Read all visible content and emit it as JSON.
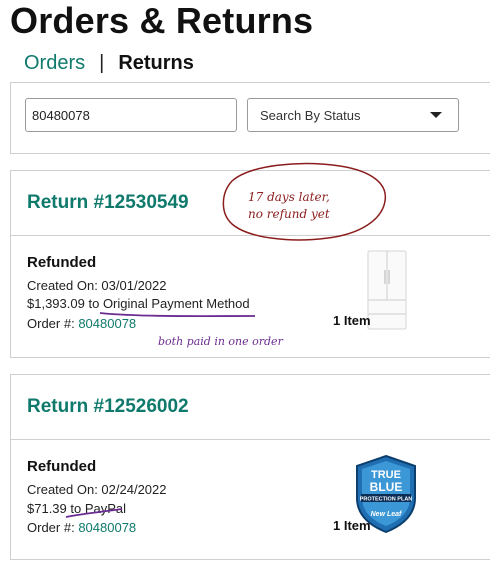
{
  "page": {
    "title": "Orders & Returns"
  },
  "tabs": {
    "orders": "Orders",
    "separator": "|",
    "returns": "Returns"
  },
  "filters": {
    "search_value": "80480078",
    "status_select": "Search By Status"
  },
  "returns": [
    {
      "title": "Return #12530549",
      "status": "Refunded",
      "created": "Created On: 03/01/2022",
      "amount": "$1,393.09",
      "to_word": "to",
      "destination": "Original Payment Method",
      "order_label": "Order #:",
      "order_number": "80480078",
      "item_count": "1 Item",
      "product_icon": "refrigerator-icon"
    },
    {
      "title": "Return #12526002",
      "status": "Refunded",
      "created": "Created On: 02/24/2022",
      "amount": "$71.39",
      "to_word": "to",
      "destination": "PayPal",
      "order_label": "Order #:",
      "order_number": "80480078",
      "item_count": "1 Item",
      "product_icon": "protection-plan-badge-icon",
      "badge": {
        "line1": "TRUE",
        "line2": "BLUE",
        "line3": "PROTECTION PLAN",
        "line4": "New Leaf"
      }
    }
  ],
  "annotations": {
    "bubble_line1": "17 days later,",
    "bubble_line2": "no refund yet",
    "purple_note": "both paid in one order",
    "ink_red": "#8b1d1d",
    "ink_purple": "#6b2c91"
  },
  "colors": {
    "accent": "#0f7a6c",
    "border": "#cfcfcf"
  }
}
